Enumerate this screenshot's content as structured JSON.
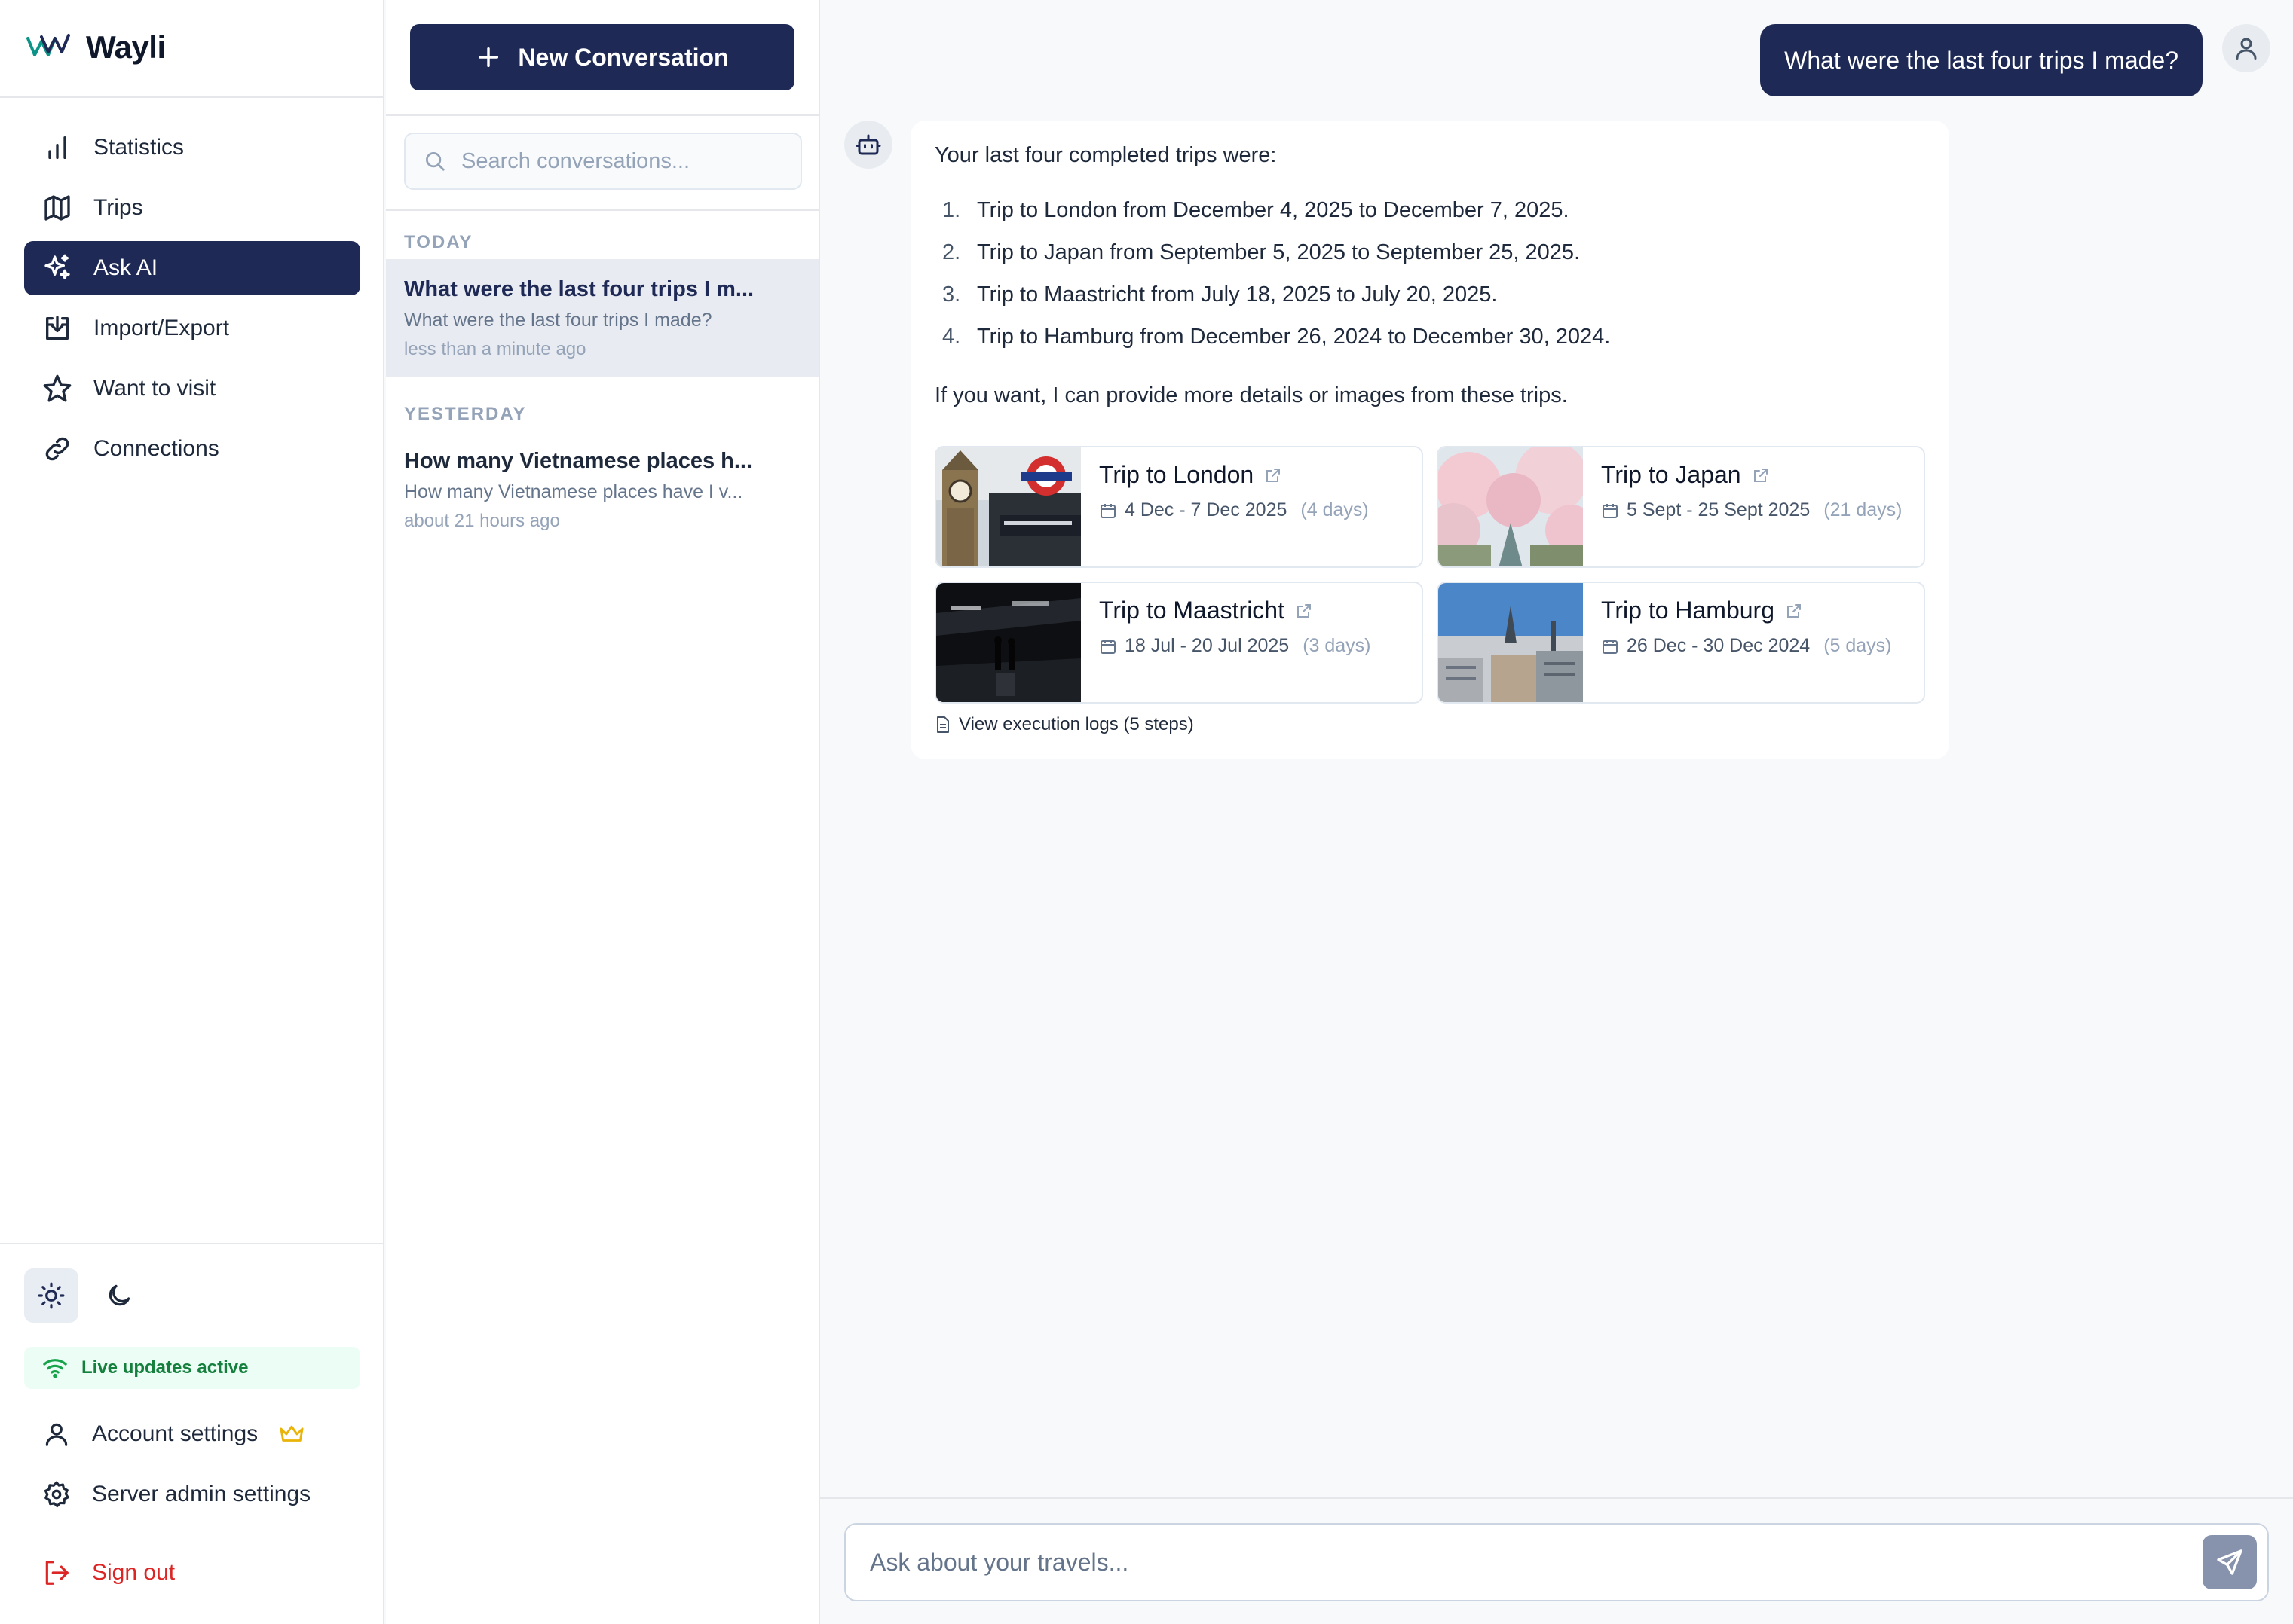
{
  "app": {
    "name": "Wayli"
  },
  "sidebar": {
    "items": [
      {
        "label": "Statistics",
        "icon": "chart-bar-icon"
      },
      {
        "label": "Trips",
        "icon": "map-icon"
      },
      {
        "label": "Ask AI",
        "icon": "sparkles-icon",
        "active": true
      },
      {
        "label": "Import/Export",
        "icon": "download-icon"
      },
      {
        "label": "Want to visit",
        "icon": "star-icon"
      },
      {
        "label": "Connections",
        "icon": "link-icon"
      }
    ],
    "live_status": "Live updates active",
    "account_settings": "Account settings",
    "server_admin": "Server admin settings",
    "sign_out": "Sign out"
  },
  "conversations": {
    "new_button": "New Conversation",
    "search_placeholder": "Search conversations...",
    "groups": [
      {
        "label": "TODAY",
        "items": [
          {
            "title": "What were the last four trips I m...",
            "preview": "What were the last four trips I made?",
            "time": "less than a minute ago",
            "active": true
          }
        ]
      },
      {
        "label": "YESTERDAY",
        "items": [
          {
            "title": "How many Vietnamese places h...",
            "preview": "How many Vietnamese places have I v...",
            "time": "about 21 hours ago",
            "active": false
          }
        ]
      }
    ]
  },
  "chat": {
    "user_message": "What were the last four trips I made?",
    "answer_intro": "Your last four completed trips were:",
    "answer_list": [
      {
        "num": "1.",
        "text": "Trip to London from December 4, 2025 to December 7, 2025."
      },
      {
        "num": "2.",
        "text": "Trip to Japan from September 5, 2025 to September 25, 2025."
      },
      {
        "num": "3.",
        "text": "Trip to Maastricht from July 18, 2025 to July 20, 2025."
      },
      {
        "num": "4.",
        "text": "Trip to Hamburg from December 26, 2024 to December 30, 2024."
      }
    ],
    "answer_outro": "If you want, I can provide more details or images from these trips.",
    "trips": [
      {
        "title": "Trip to London",
        "dates": "4 Dec - 7 Dec 2025",
        "days": "(4 days)"
      },
      {
        "title": "Trip to Japan",
        "dates": "5 Sept - 25 Sept 2025",
        "days": "(21 days)"
      },
      {
        "title": "Trip to Maastricht",
        "dates": "18 Jul - 20 Jul 2025",
        "days": "(3 days)"
      },
      {
        "title": "Trip to Hamburg",
        "dates": "26 Dec - 30 Dec 2024",
        "days": "(5 days)"
      }
    ],
    "logs_link": "View execution logs (5 steps)",
    "composer_placeholder": "Ask about your travels..."
  },
  "colors": {
    "primary": "#1e2a55",
    "live_green": "#15803d",
    "sign_out_red": "#dc2626",
    "crown_gold": "#eab308"
  }
}
